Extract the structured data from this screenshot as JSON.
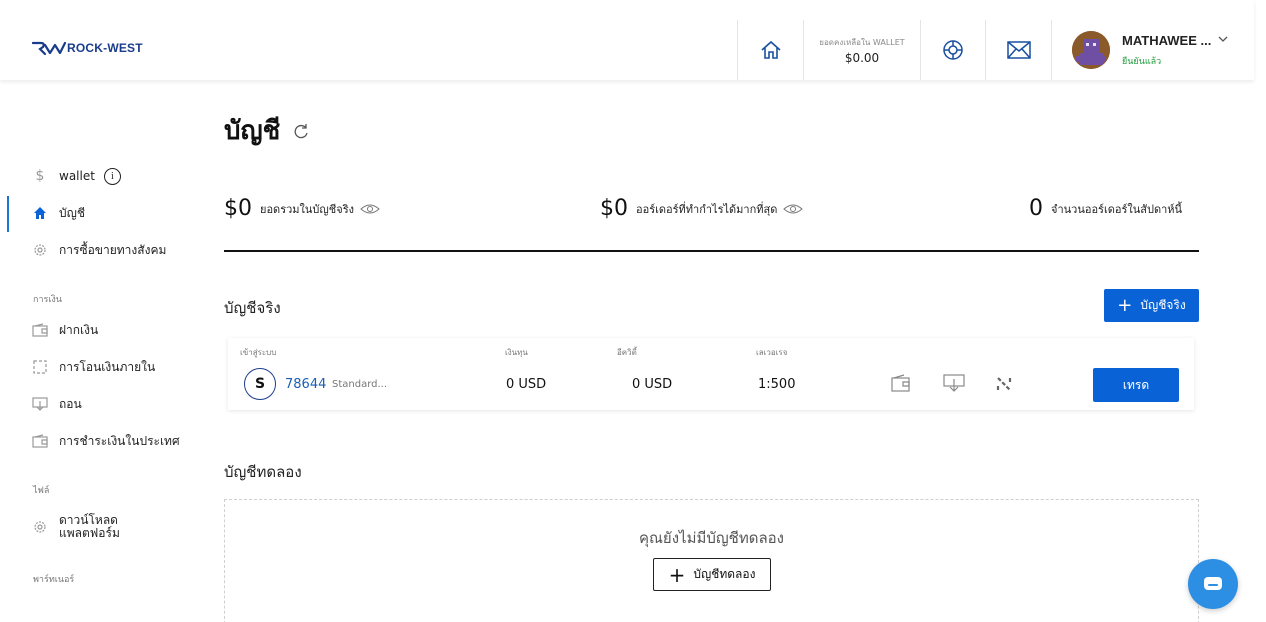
{
  "brand": {
    "logo_text": "ROCK-WEST"
  },
  "header": {
    "wallet_label": "ยอดคงเหลือใน WALLET",
    "wallet_value": "$0.00",
    "user_name": "MATHAWEE ...",
    "user_status": "ยืนยันแล้ว",
    "icons": [
      "home-icon",
      "support-icon",
      "mail-icon",
      "chevron-down-icon"
    ]
  },
  "sidebar": {
    "items": [
      {
        "label": "wallet",
        "icon": "dollar-icon"
      },
      {
        "label": "บัญชี",
        "icon": "home-icon",
        "active": true
      },
      {
        "label": "การซื้อขายทางสังคม",
        "icon": "gear-icon"
      },
      {
        "label": "ฝากเงิน",
        "icon": "wallet-icon"
      },
      {
        "label": "การโอนเงินภายใน",
        "icon": "transfer-icon"
      },
      {
        "label": "ถอน",
        "icon": "withdraw-icon"
      },
      {
        "label": "การชำระเงินในประเทศ",
        "icon": "wallet-icon"
      },
      {
        "label_line1": "ดาวน์โหลด",
        "label_line2": "แพลตฟอร์ม",
        "icon": "gear-icon"
      }
    ],
    "sections": {
      "finance": "การเงิน",
      "files": "ไฟล์",
      "partner": "พาร์ทเนอร์"
    }
  },
  "main": {
    "title": "บัญชี",
    "stats": [
      {
        "value": "$0",
        "label": "ยอดรวมในบัญชีจริง"
      },
      {
        "value": "$0",
        "label": "ออร์เดอร์ที่ทำกำไรได้มากที่สุด"
      },
      {
        "value": "0",
        "label": "จำนวนออร์เดอร์ในสัปดาห์นี้"
      }
    ],
    "real_accounts": {
      "title": "บัญชีจริง",
      "add_button": "บัญชีจริง",
      "columns": [
        "เข้าสู่ระบบ",
        "เงินทุน",
        "อีควิตี้",
        "เลเวอเรจ"
      ],
      "rows": [
        {
          "badge": "S",
          "login": "78644",
          "type": "Standard...",
          "balance": "0 USD",
          "equity": "0 USD",
          "leverage": "1:500",
          "trade_button": "เทรด"
        }
      ]
    },
    "demo_accounts": {
      "title": "บัญชีทดลอง",
      "empty_text": "คุณยังไม่มีบัญชีทดลอง",
      "add_button": "บัญชีทดลอง"
    }
  },
  "colors": {
    "primary": "#0a63d6",
    "verified": "#1f9a3a",
    "link": "#1a5fb4",
    "chat": "#2c8fe4"
  }
}
